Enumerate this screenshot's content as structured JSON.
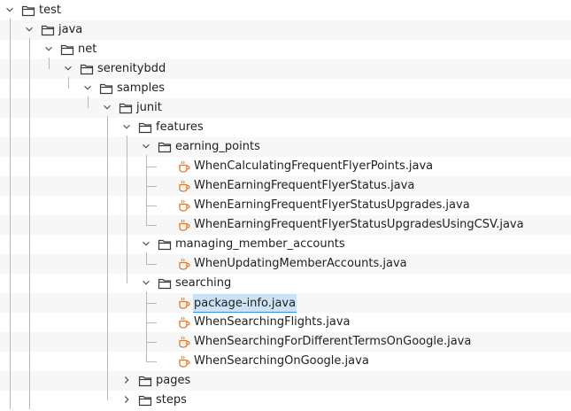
{
  "tree": {
    "rows": [
      {
        "label": "test",
        "kind": "folder",
        "expanded": true
      },
      {
        "label": "java",
        "kind": "folder",
        "expanded": true
      },
      {
        "label": "net",
        "kind": "folder",
        "expanded": true
      },
      {
        "label": "serenitybdd",
        "kind": "folder",
        "expanded": true
      },
      {
        "label": "samples",
        "kind": "folder",
        "expanded": true
      },
      {
        "label": "junit",
        "kind": "folder",
        "expanded": true
      },
      {
        "label": "features",
        "kind": "folder",
        "expanded": true
      },
      {
        "label": "earning_points",
        "kind": "folder",
        "expanded": true
      },
      {
        "label": "WhenCalculatingFrequentFlyerPoints.java",
        "kind": "java-file"
      },
      {
        "label": "WhenEarningFrequentFlyerStatus.java",
        "kind": "java-file"
      },
      {
        "label": "WhenEarningFrequentFlyerStatusUpgrades.java",
        "kind": "java-file"
      },
      {
        "label": "WhenEarningFrequentFlyerStatusUpgradesUsingCSV.java",
        "kind": "java-file"
      },
      {
        "label": "managing_member_accounts",
        "kind": "folder",
        "expanded": true
      },
      {
        "label": "WhenUpdatingMemberAccounts.java",
        "kind": "java-file"
      },
      {
        "label": "searching",
        "kind": "folder",
        "expanded": true
      },
      {
        "label": "package-info.java",
        "kind": "java-file",
        "selected": true
      },
      {
        "label": "WhenSearchingFlights.java",
        "kind": "java-file"
      },
      {
        "label": "WhenSearchingForDifferentTermsOnGoogle.java",
        "kind": "java-file"
      },
      {
        "label": "WhenSearchingOnGoogle.java",
        "kind": "java-file"
      },
      {
        "label": "pages",
        "kind": "folder",
        "expanded": false
      },
      {
        "label": "steps",
        "kind": "folder",
        "expanded": false
      }
    ]
  },
  "colors": {
    "selection": "#cde3f5",
    "java_icon": "#e07a2c",
    "folder_icon": "#3a3a3a"
  }
}
